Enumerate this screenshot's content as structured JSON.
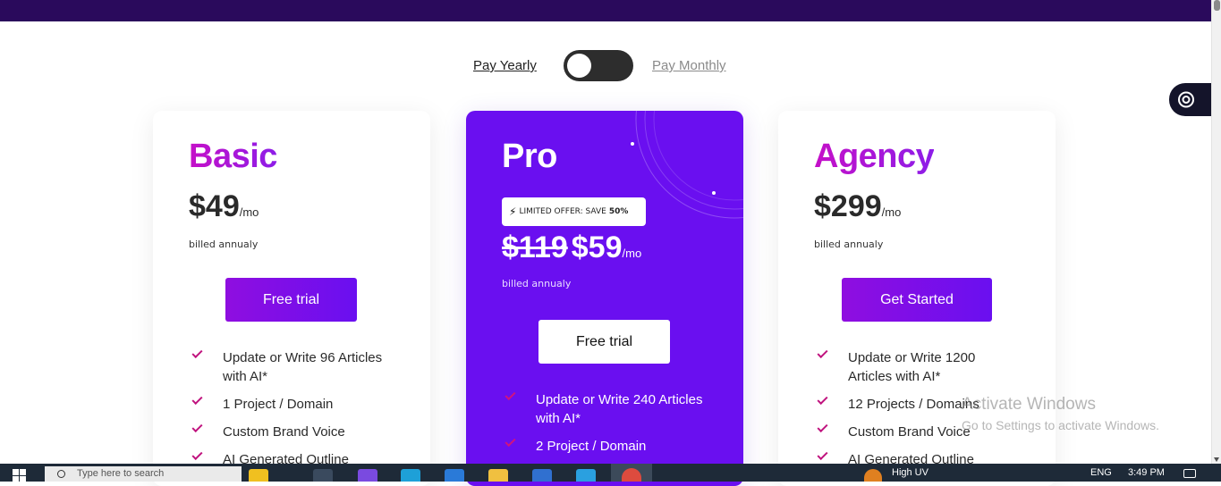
{
  "billing_toggle": {
    "yearly_label": "Pay Yearly",
    "monthly_label": "Pay Monthly",
    "state": "yearly"
  },
  "plans": [
    {
      "name": "Basic",
      "price": "$49",
      "per": "/mo",
      "billed": "billed annualy",
      "cta": "Free trial",
      "features": [
        "Update or Write 96 Articles with AI*",
        "1 Project / Domain",
        "Custom Brand Voice",
        "AI Generated Outline"
      ]
    },
    {
      "name": "Pro",
      "offer_prefix": "LIMITED OFFER: SAVE",
      "offer_value": "50%",
      "old_price": "$119",
      "price": "$59",
      "per": "/mo",
      "billed": "billed annualy",
      "cta": "Free trial",
      "features": [
        "Update or Write 240 Articles with AI*",
        "2 Project / Domain"
      ]
    },
    {
      "name": "Agency",
      "price": "$299",
      "per": "/mo",
      "billed": "billed annualy",
      "cta": "Get Started",
      "features": [
        "Update or Write 1200 Articles with AI*",
        "12 Projects / Domains",
        "Custom Brand Voice",
        "AI Generated Outline"
      ]
    }
  ],
  "watermark": {
    "title": "Activate Windows",
    "subtitle": "Go to Settings to activate Windows."
  },
  "taskbar": {
    "search_placeholder": "Type here to search",
    "weather": "High UV",
    "language": "ENG",
    "time": "3:49 PM"
  },
  "colors": {
    "header_bar": "#2a0a5c",
    "pro_card": "#6a0ff0",
    "cta_gradient_start": "#8f0ee0",
    "cta_gradient_end": "#6a0ff0",
    "check": "#c0137e"
  }
}
